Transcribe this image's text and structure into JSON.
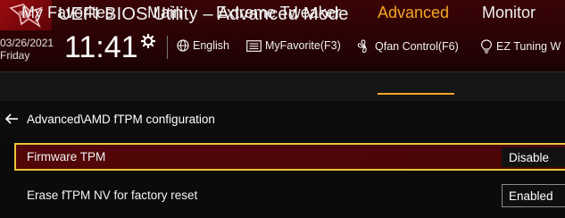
{
  "app": {
    "title": "UEFI BIOS Utility – Advanced Mode",
    "date": "03/26/2021",
    "day": "Friday",
    "time": "11:41"
  },
  "toolbar": {
    "language": "English",
    "myfavorite": "MyFavorite(F3)",
    "qfan": "Qfan Control(F6)",
    "ez_tuning": "EZ Tuning W"
  },
  "menu": {
    "items": [
      "My Favorites",
      "Main",
      "Extreme Tweaker",
      "Advanced",
      "Monitor"
    ],
    "active": "Advanced"
  },
  "breadcrumb": "Advanced\\AMD fTPM configuration",
  "settings": [
    {
      "label": "Firmware TPM",
      "value": "Disable",
      "selected": true
    },
    {
      "label": "Erase fTPM NV for factory reset",
      "value": "Enabled",
      "selected": false
    }
  ],
  "colors": {
    "accent": "#f5a623",
    "highlight_border": "#e8c63a",
    "header_red": "#3a0406",
    "selected_row": "#530608"
  },
  "icons": {
    "logo": "rog-logo-icon",
    "gear": "gear-icon",
    "globe": "globe-icon",
    "favorite": "favorite-list-icon",
    "fan": "fan-icon",
    "bulb": "lightbulb-icon",
    "back": "back-arrow-icon"
  }
}
